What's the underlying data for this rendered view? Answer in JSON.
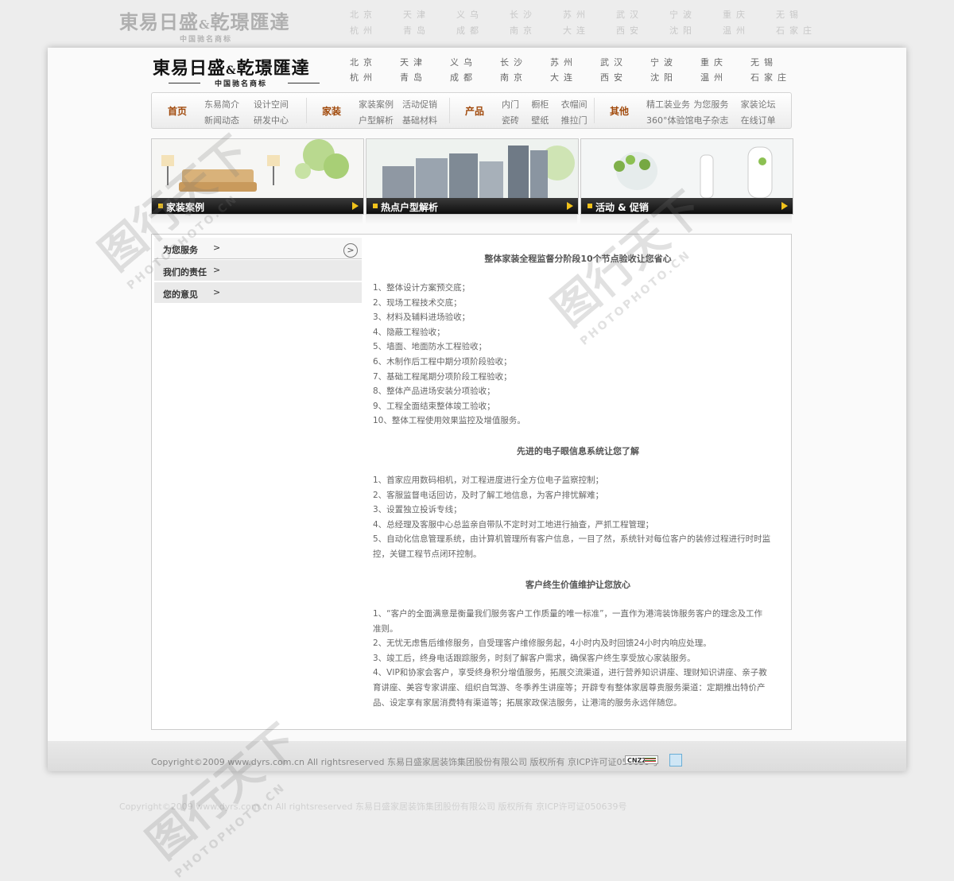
{
  "header": {
    "logo_main": "東易日盛",
    "logo_amp": "&",
    "logo_second": "乾璟匯達",
    "logo_sub": "中国驰名商标"
  },
  "cities": [
    "北京",
    "天津",
    "义乌",
    "长沙",
    "苏州",
    "武汉",
    "宁波",
    "重庆",
    "无锡",
    "杭州",
    "青岛",
    "成都",
    "南京",
    "大连",
    "西安",
    "沈阳",
    "温州",
    "石家庄"
  ],
  "nav": {
    "groups": [
      {
        "title": "首页",
        "links": [
          "东易简介",
          "设计空间",
          "新闻动态",
          "研发中心"
        ]
      },
      {
        "title": "家装",
        "links": [
          "家装案例",
          "活动促销",
          "户型解析",
          "基础材料"
        ]
      },
      {
        "title": "产品",
        "links": [
          "内门",
          "橱柜",
          "衣帽间",
          "瓷砖",
          "壁纸",
          "推拉门"
        ]
      },
      {
        "title": "其他",
        "links": [
          "精工装业务",
          "为您服务",
          "家装论坛",
          "360°体验馆",
          "电子杂志",
          "在线订单"
        ]
      }
    ]
  },
  "banners": [
    {
      "label": "家装案例"
    },
    {
      "label": "热点户型解析"
    },
    {
      "label": "活动 & 促销"
    }
  ],
  "sidebar": {
    "items": [
      {
        "label": "为您服务",
        "arrow": ">"
      },
      {
        "label": "我们的责任",
        "arrow": ">"
      },
      {
        "label": "您的意见",
        "arrow": ">"
      }
    ],
    "circle_arrow": ">"
  },
  "article": {
    "sections": [
      {
        "title": "整体家装全程监督分阶段10个节点验收让您省心",
        "lines": [
          "1、整体设计方案预交底；",
          "2、现场工程技术交底；",
          "3、材料及辅料进场验收；",
          "4、隐蔽工程验收；",
          "5、墙面、地面防水工程验收；",
          "6、木制作后工程中期分项阶段验收；",
          "7、基础工程尾期分项阶段工程验收；",
          "8、整体产品进场安装分项验收；",
          "9、工程全面结束整体竣工验收；",
          "10、整体工程使用效果监控及增值服务。"
        ]
      },
      {
        "title": "先进的电子眼信息系统让您了解",
        "lines": [
          "1、首家应用数码相机，对工程进度进行全方位电子监察控制；",
          "2、客服监督电话回访，及时了解工地信息，为客户排忧解难；",
          "3、设置独立投诉专线；",
          "4、总经理及客服中心总监亲自带队不定时对工地进行抽查，严抓工程管理；",
          "5、自动化信息管理系统，由计算机管理所有客户信息，一目了然，系统针对每位客户的装修过程进行时时监",
          "控，关键工程节点闭环控制。"
        ]
      },
      {
        "title": "客户终生价值维护让您放心",
        "lines": [
          "1、“客户的全面满意是衡量我们服务客户工作质量的唯一标准”，一直作为港湾装饰服务客户的理念及工作",
          "准则。",
          "2、无忧无虑售后维修服务，自受理客户维修服务起，4小时内及时回馈24小时内响应处理。",
          "3、竣工后，终身电话跟踪服务，时刻了解客户需求，确保客户终生享受放心家装服务。",
          "4、VIP和协家会客户，享受终身积分增值服务，拓展交流渠道，进行营养知识讲座、理财知识讲座、亲子教",
          "育讲座、美容专家讲座、组织自驾游、冬季养生讲座等；开辟专有整体家居尊贵服务渠道：定期推出特价产",
          "品、设定享有家居消费特有渠道等；拓展家政保洁服务，让港湾的服务永远伴随您。"
        ]
      }
    ]
  },
  "footer": {
    "copyright": "Copyright©2009 www.dyrs.com.cn All rightsreserved 东易日盛家居装饰集团股份有限公司 版权所有 京ICP许可证050639号",
    "badge": "CNZZ"
  },
  "watermark": {
    "big": "图行天下",
    "small": "PHOTOPHOTO.CN"
  },
  "colors": {
    "nav_title": "#a14a0c",
    "banner_accent": "#f1c21b",
    "banner_bar": "#111111"
  }
}
